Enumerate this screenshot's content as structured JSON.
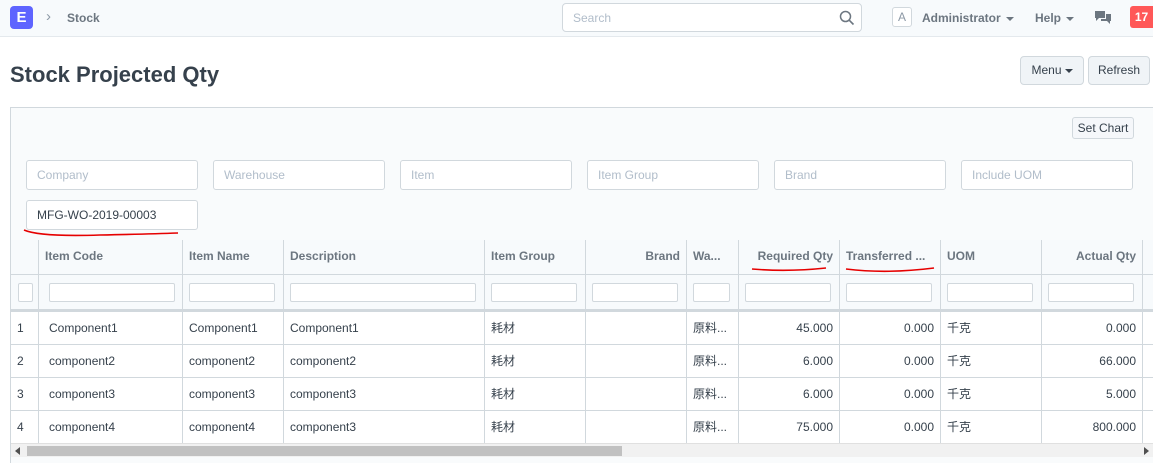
{
  "navbar": {
    "logo": "E",
    "breadcrumb": "Stock",
    "search_placeholder": "Search",
    "avatar_letter": "A",
    "user": "Administrator",
    "help": "Help",
    "notifications": "17"
  },
  "page": {
    "title": "Stock Projected Qty",
    "menu_label": "Menu",
    "refresh_label": "Refresh",
    "set_chart_label": "Set Chart"
  },
  "filters": {
    "company": "Company",
    "warehouse": "Warehouse",
    "item": "Item",
    "item_group": "Item Group",
    "brand": "Brand",
    "include_uom": "Include UOM",
    "work_order": "MFG-WO-2019-00003"
  },
  "columns": [
    "",
    "Item Code",
    "Item Name",
    "Description",
    "Item Group",
    "Brand",
    "Wa...",
    "Required Qty",
    "Transferred ...",
    "UOM",
    "Actual Qty"
  ],
  "rows": [
    [
      "1",
      "Component1",
      "Component1",
      "Component1",
      "耗材",
      "",
      "原料...",
      "45.000",
      "0.000",
      "千克",
      "0.000"
    ],
    [
      "2",
      "component2",
      "component2",
      "component2",
      "耗材",
      "",
      "原料...",
      "6.000",
      "0.000",
      "千克",
      "66.000"
    ],
    [
      "3",
      "component3",
      "component3",
      "component3",
      "耗材",
      "",
      "原料...",
      "6.000",
      "0.000",
      "千克",
      "5.000"
    ],
    [
      "4",
      "component4",
      "component4",
      "component3",
      "耗材",
      "",
      "原料...",
      "75.000",
      "0.000",
      "千克",
      "800.000"
    ]
  ],
  "colors": {
    "accent": "#5e64ff",
    "notification": "#ff5858",
    "annotation": "#e60000"
  }
}
